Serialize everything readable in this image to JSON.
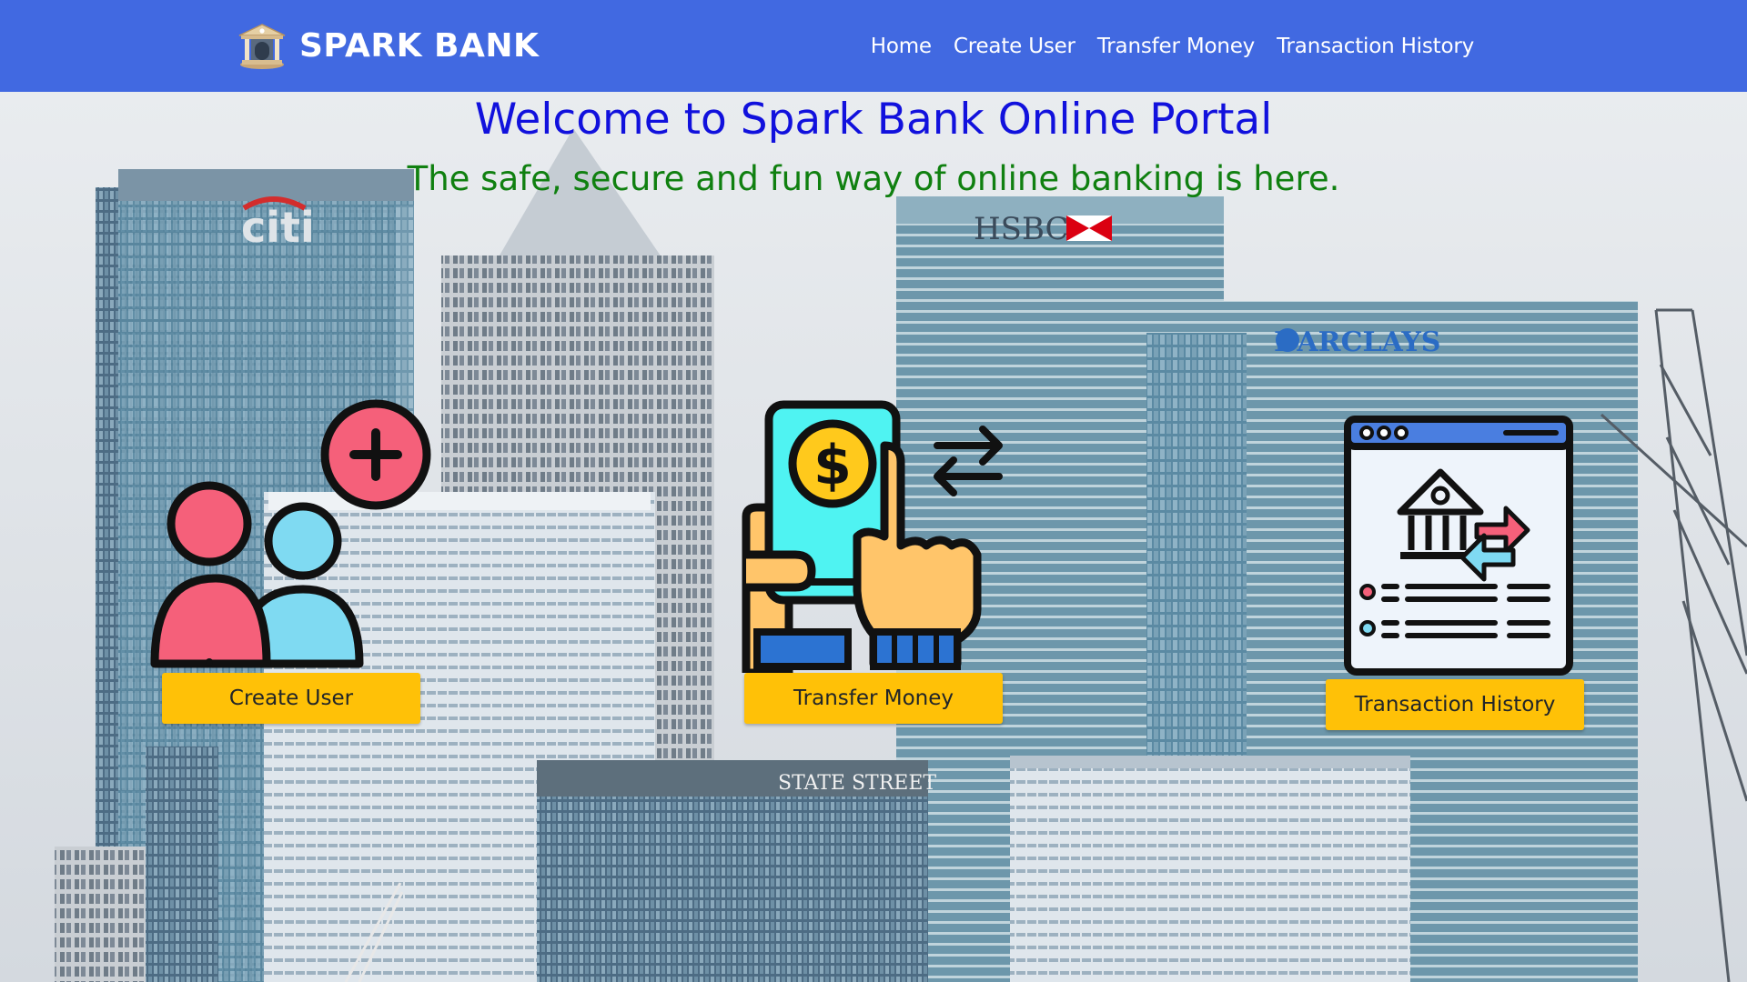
{
  "navbar": {
    "brand": {
      "icon": "bank-icon",
      "label": "SPARK BANK"
    },
    "links": [
      {
        "label": "Home"
      },
      {
        "label": "Create User"
      },
      {
        "label": "Transfer Money"
      },
      {
        "label": "Transaction History"
      }
    ],
    "background_color": "#4169e1"
  },
  "hero": {
    "title": "Welcome to Spark Bank Online Portal",
    "subtitle": "The safe, secure and fun way of online banking is here.",
    "title_color": "#1111dd",
    "subtitle_color": "#108010",
    "background": {
      "description_icon": "city-skyline-image",
      "building_signs": [
        "citi",
        "HSBC",
        "BARCLAYS",
        "STATE STREET"
      ]
    }
  },
  "cards": [
    {
      "icon": "add-users-icon",
      "button_label": "Create User"
    },
    {
      "icon": "mobile-payment-icon",
      "button_label": "Transfer Money"
    },
    {
      "icon": "transaction-history-icon",
      "button_label": "Transaction History"
    }
  ],
  "colors": {
    "button": "#ffc107",
    "button_text": "#212529"
  }
}
